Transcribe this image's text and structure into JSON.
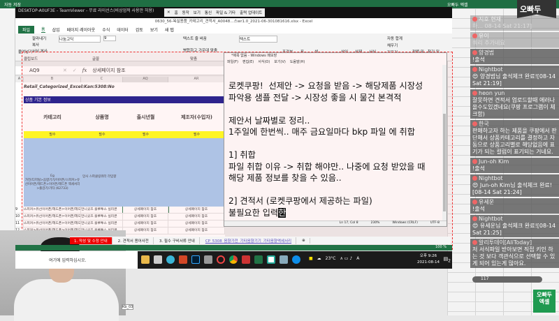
{
  "host": {
    "title": "자동 저장",
    "user": "오빠두 엑셀"
  },
  "teamviewer": {
    "title": "DESKTOP-A0UF3E - TeamViewer - 무료 라이선스(비상업적 사용만 허용)",
    "tools": [
      "홈",
      "동작",
      "보기",
      "통신",
      "파일 & 기타",
      "출력 업데이트"
    ]
  },
  "excel": {
    "title": "0630_56-욕실용품_카테고리_견적서_A0048…스wr1.0_2021-06-301081616.xlsx - Excel",
    "tabs": [
      "파일",
      "홈",
      "삽입",
      "페이지 레이아웃",
      "수식",
      "데이터",
      "검토",
      "보기",
      "새 탭"
    ],
    "ribbon": {
      "paste": "붙여넣기",
      "cut": "잘라내기",
      "copy": "복사",
      "format_painter": "서식 복사",
      "font": "나눔고딕",
      "font_size": "9",
      "wrap": "텍스트 줄 바꿈",
      "merge": "병합하고 가운데 맞춤",
      "number_format": "텍스트",
      "conditional": "조건부",
      "table": "표",
      "cell": "셀",
      "insert": "삽입",
      "delete": "삭제",
      "format": "서식",
      "autosum": "자동 합계",
      "fill": "채우기",
      "clear": "지우기",
      "sort": "정렬 및",
      "find": "찾기 및",
      "groups": [
        "클립보드",
        "글꼴",
        "맞춤"
      ]
    },
    "name_box": "AQ9",
    "formula": "상세페이지 참조",
    "fx": "fx",
    "columns": [
      "A",
      "B",
      "C",
      "AQ",
      "AR"
    ],
    "header_text": "Retail_Categorized_Excel:Kan:5308:No",
    "section": "상품 기본 정보",
    "headers": [
      "카테고리",
      "상품명",
      "출시년월",
      "제조자(수입자)"
    ],
    "required": "필수",
    "example_label": "Eg",
    "example_category": "가전/디지털>음향기기/이어폰/스피커>유선이어폰/헤드폰>이어폰/헤드폰 액세서리>출감기/기타 (62733)",
    "example_name": "망사 스파클링워터 라임향",
    "rows": [
      {
        "num": "9",
        "cat": "스피커>유선이어폰/헤드폰>이어폰/헤드",
        "name": "언니곳즈 블루투스 실리콘",
        "aq": "상세페이지 참조",
        "ar": "상세페이지 참조"
      },
      {
        "num": "10",
        "cat": "스피커>유선이어폰/헤드폰>이어폰/헤드",
        "name": "언니곳즈 블루투스 실리콘",
        "aq": "상세페이지 참조",
        "ar": "상세페이지 참조"
      },
      {
        "num": "11",
        "cat": "스피커>유선이어폰/헤드폰>이어폰/헤드",
        "name": "언니곳즈 블루투스 실리콘",
        "aq": "상세페이지 참조",
        "ar": "상세페이지 참조"
      },
      {
        "num": "12",
        "cat": "스피커>유선이어폰/헤드폰>이어폰/헤드",
        "name": "언니곳즈 블루투스 실리콘",
        "aq": "상세페이지 참조",
        "ar": "상세페이지 참조"
      }
    ],
    "sheet_tabs": [
      "1. 작성 및 수정 안내",
      "2. 견적서 용어사전",
      "3. 필수 구비서류 안내",
      "CP_5308_음향가전_기타음향기기_기타음향액세서리"
    ],
    "zoom": "100 %"
  },
  "notepad": {
    "title": "*제목 없음 - Windows 메모장",
    "menu": [
      "파일(F)",
      "편집(E)",
      "서식(O)",
      "보기(V)",
      "도움말(H)"
    ],
    "text": "로켓쿠팡!  선제안 -> 요청을 받음 -> 해당제품 시장성\n파악용 샘플 전달 -> 시장성 좋을 시 물건 본격적\n\n제안서 날짜별로 정리..\n1주일에 한번씩.. 매주 금요일마다 bkp 파일 에 취합\n\n1] 취합\n파일 취합 이유 -> 취합 해야만.. 나중에 요청 받았을 때\n해당 제품 정보를 찾을 수 있음..\n\n2] 견적서 (로켓쿠팡에서 제공하는 파일)\n불필요한 입력",
    "composing": "한",
    "status": [
      "Ln 17, Col 8",
      "230%",
      "Windows (CRLF)",
      "UTF-8"
    ]
  },
  "taskbar": {
    "search": "여기에 입력하십시오.",
    "weather": "23°C",
    "ime": "A",
    "time": "오후 9:26",
    "date": "2021-08-14",
    "notif": "2"
  },
  "chat": {
    "messages": [
      {
        "user": "지호 현재",
        "text": "하... 08-14 Sat 21:17]",
        "faint": true
      },
      {
        "user": "유이",
        "text": "쿼리 추가네요",
        "faint": true
      },
      {
        "user": "양경범",
        "text": "!출석"
      },
      {
        "user": "Nightbot",
        "text": "😍 양경범님 출석체크 완료![08-14 Sat 21:19]"
      },
      {
        "user": "heon yun",
        "text": "잘못하면 견적서 업로드할때 에러나올수도있겠네요(쿠팡 프로그램이 체크함)"
      },
      {
        "user": "한국",
        "text": "판매하고자 하는 제품을 쿠팡에서 판단해서 상품카테고리를 결정하고 자동으로 상품고리별로 해당없음에 표기가 되는 컬럼이 표기되는 거네요."
      },
      {
        "user": "Jun-oh Kim",
        "text": "!출석"
      },
      {
        "user": "Nightbot",
        "text": "😍 Jun-oh Kim님 출석체크 완료![08-14 Sat 21:24]"
      },
      {
        "user": "유세운",
        "text": "!출석"
      },
      {
        "user": "Nightbot",
        "text": "😍 유세운님 출석체크 완료![08-14 Sat 21:25]"
      },
      {
        "user": "알리투데이[AliToday]",
        "text": "저 서식파일 받아보면 직접 키인 하는 것 보다 객관식으로 선택할 수 있게 되어 있는게 많아요."
      }
    ],
    "viewer_count": "117"
  },
  "logo": {
    "brand": "오빠두",
    "mini": "오빠두 엑셀"
  },
  "webcam_tag": "Kb_03"
}
